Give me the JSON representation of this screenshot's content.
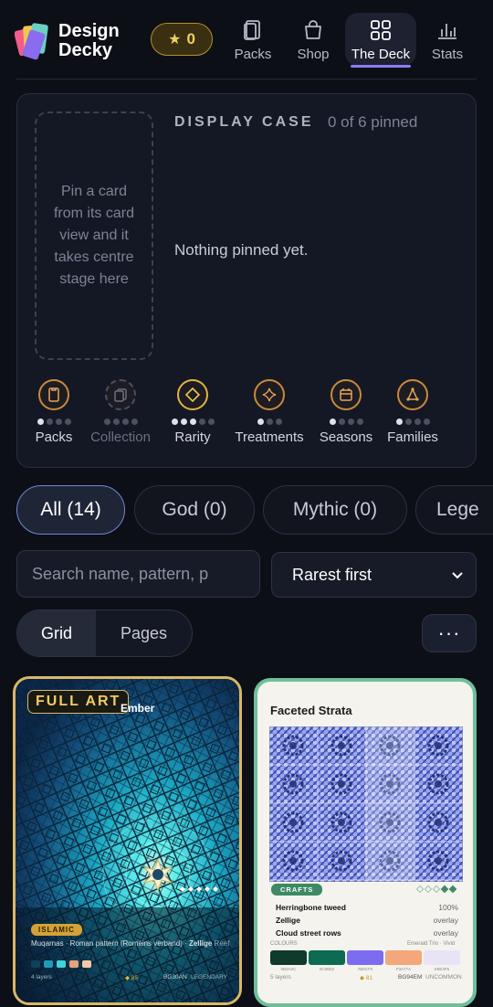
{
  "brand": {
    "line1": "Design",
    "line2": "Decky"
  },
  "coins": {
    "star": "★",
    "value": "0"
  },
  "nav": [
    {
      "label": "Packs",
      "icon": "packs-icon"
    },
    {
      "label": "Shop",
      "icon": "shop-bag-icon"
    },
    {
      "label": "The Deck",
      "icon": "grid-icon",
      "active": true
    },
    {
      "label": "Stats",
      "icon": "bar-chart-icon"
    }
  ],
  "display_case": {
    "title": "DISPLAY CASE",
    "count": "0 of 6 pinned",
    "slot_hint": "Pin a card from its card view and it takes centre stage here",
    "empty": "Nothing pinned yet.",
    "badges": [
      {
        "label": "Packs",
        "dots": [
          1,
          0,
          0,
          0
        ]
      },
      {
        "label": "Collection",
        "dots": [
          0,
          0,
          0,
          0
        ]
      },
      {
        "label": "Rarity",
        "dots": [
          1,
          1,
          1,
          0,
          0
        ]
      },
      {
        "label": "Treatments",
        "dots": [
          1,
          0,
          0
        ]
      },
      {
        "label": "Seasons",
        "dots": [
          1,
          0,
          0,
          0
        ]
      },
      {
        "label": "Families",
        "dots": [
          1,
          0,
          0,
          0
        ]
      }
    ]
  },
  "filters": {
    "pills": [
      "All (14)",
      "God (0)",
      "Mythic (0)",
      "Lege"
    ],
    "search_placeholder": "Search name, pattern, p",
    "sort": "Rarest first",
    "view": {
      "grid": "Grid",
      "pages": "Pages"
    },
    "more": "···"
  },
  "cards": [
    {
      "tag": "FULL ART",
      "name": "Ember",
      "category": "ISLAMIC",
      "desc_a": "Muqarnas · Roman pattern (Romeins verband) · ",
      "desc_b": "Zellige",
      "desc_c": " Reef",
      "foot_left": "4 layers",
      "foot_mid": "◆ 85",
      "foot_code": "BG30AN",
      "foot_rarity": "LEGENDARY",
      "swatches": [
        "#10415a",
        "#1f9bb8",
        "#3ed3d6",
        "#e9a07c",
        "#f6c9a8"
      ]
    },
    {
      "name": "Faceted Strata",
      "category": "CRAFTS",
      "rows": [
        {
          "name": "Herringbone tweed",
          "value": "100%"
        },
        {
          "name": "Zellige",
          "value": "overlay"
        },
        {
          "name": "Cloud street rows",
          "value": "overlay"
        }
      ],
      "colours_label": "COLOURS",
      "palette_name": "Emerald Trio · Vivid",
      "palette": [
        "#0f3a2c",
        "#0c6b52",
        "#1a7b63",
        "#7b6cf0",
        "#f3a77a",
        "#e8e4f6"
      ],
      "palette_hex": [
        "0B3A2C",
        "0C6B52",
        "1A7B63",
        "7B6CF0",
        "F3A77A",
        "E8E4F6"
      ],
      "foot_left": "5 layers",
      "foot_mid": "◆ 81",
      "foot_code": "BG94EM",
      "foot_rarity": "UNCOMMON"
    }
  ]
}
